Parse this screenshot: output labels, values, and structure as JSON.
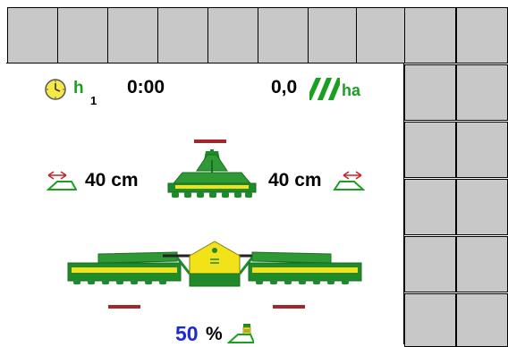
{
  "counters": {
    "hours_unit": "h",
    "hours_index": "1",
    "hours_value": "0:00",
    "area_value": "0,0",
    "area_unit": "ha"
  },
  "widths": {
    "left": "40 cm",
    "right": "40 cm"
  },
  "pressure": {
    "value": "50",
    "unit": "%"
  },
  "colors": {
    "button_gray": "#c8c8c8",
    "accent_green": "#1aa021",
    "machine_green": "#1f8a2a",
    "machine_yellow": "#f2e21a",
    "dash_red": "#a3262a",
    "value_blue": "#1a2bd6"
  }
}
